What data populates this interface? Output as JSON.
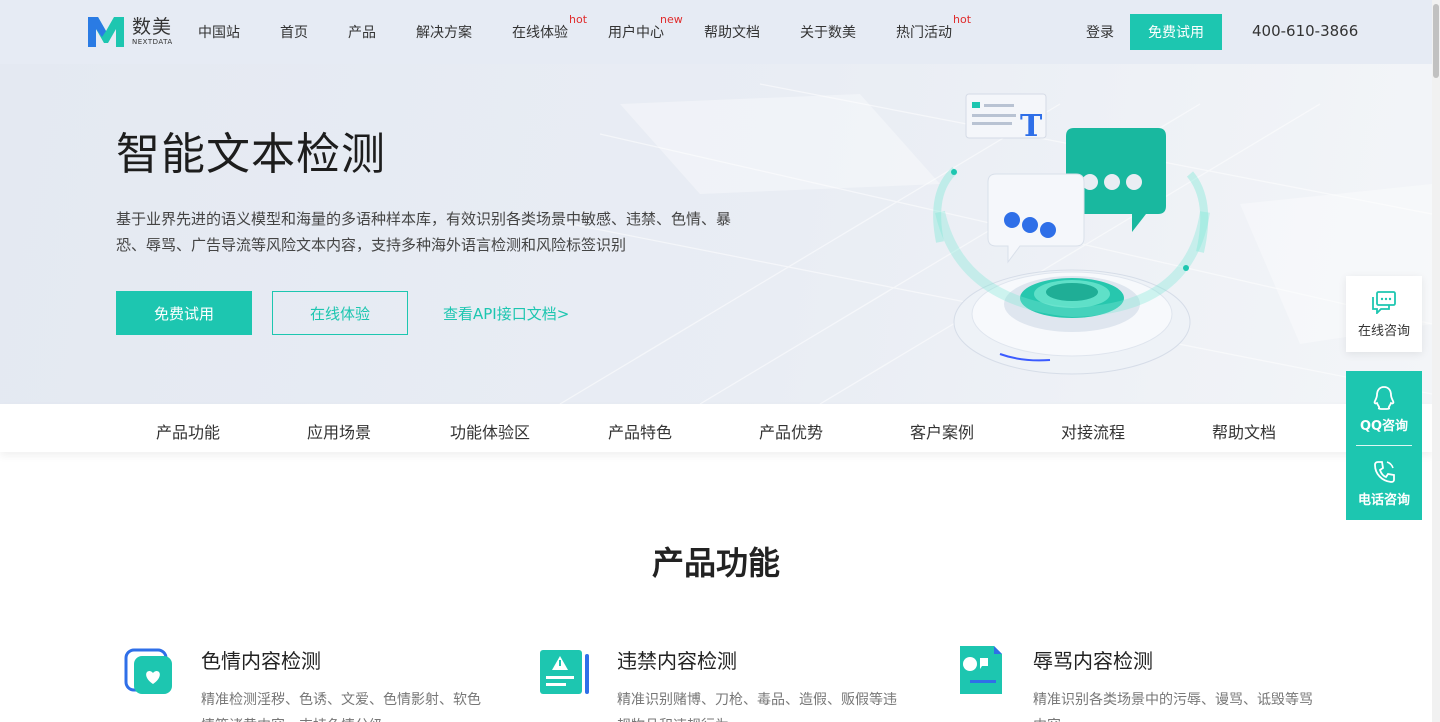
{
  "header": {
    "logo_cn": "数美",
    "logo_en": "NEXTDATA",
    "nav": [
      {
        "label": "中国站",
        "tag": ""
      },
      {
        "label": "首页",
        "tag": ""
      },
      {
        "label": "产品",
        "tag": ""
      },
      {
        "label": "解决方案",
        "tag": ""
      },
      {
        "label": "在线体验",
        "tag": "hot"
      },
      {
        "label": "用户中心",
        "tag": "new"
      },
      {
        "label": "帮助文档",
        "tag": ""
      },
      {
        "label": "关于数美",
        "tag": ""
      },
      {
        "label": "热门活动",
        "tag": "hot"
      }
    ],
    "login": "登录",
    "trial": "免费试用",
    "phone": "400-610-3866"
  },
  "hero": {
    "title": "智能文本检测",
    "description": "基于业界先进的语义模型和海量的多语种样本库，有效识别各类场景中敏感、违禁、色情、暴恐、辱骂、广告导流等风险文本内容，支持多种海外语言检测和风险标签识别",
    "btn_trial": "免费试用",
    "btn_experience": "在线体验",
    "api_link": "查看API接口文档>"
  },
  "subnav": [
    "产品功能",
    "应用场景",
    "功能体验区",
    "产品特色",
    "产品优势",
    "客户案例",
    "对接流程",
    "帮助文档"
  ],
  "features": {
    "title": "产品功能",
    "items": [
      {
        "title": "色情内容检测",
        "desc": "精准检测淫秽、色诱、文爱、色情影射、软色情等诸黄内容，支持色情分级"
      },
      {
        "title": "违禁内容检测",
        "desc": "精准识别赌博、刀枪、毒品、造假、贩假等违规物品和违规行为"
      },
      {
        "title": "辱骂内容检测",
        "desc": "精准识别各类场景中的污辱、谩骂、诋毁等骂内容"
      }
    ]
  },
  "floating": {
    "online": "在线咨询",
    "qq": "QQ咨询",
    "tel": "电话咨询"
  },
  "colors": {
    "accent": "#1dc6b0",
    "hot": "#e02b2b",
    "nav_bg": "#e6ebf4"
  }
}
